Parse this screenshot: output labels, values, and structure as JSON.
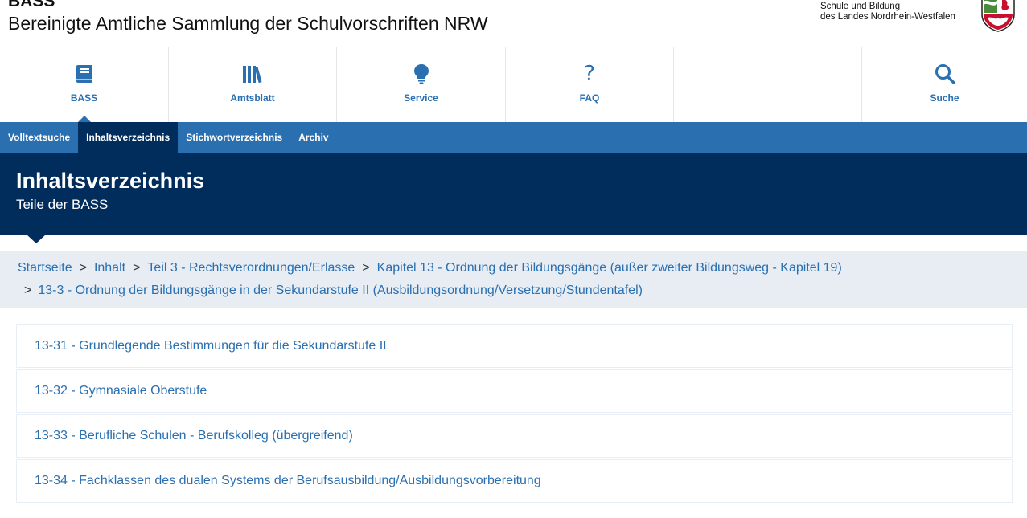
{
  "header": {
    "short_title": "BASS",
    "title": "Bereinigte Amtliche Sammlung der Schulvorschriften NRW",
    "ministry_line1": "Schule und Bildung",
    "ministry_line2": "des Landes Nordrhein-Westfalen"
  },
  "mainnav": [
    {
      "label": "BASS",
      "icon": "book-icon"
    },
    {
      "label": "Amtsblatt",
      "icon": "books-icon"
    },
    {
      "label": "Service",
      "icon": "lightbulb-icon"
    },
    {
      "label": "FAQ",
      "icon": "question-icon"
    },
    {
      "label": "Suche",
      "icon": "search-icon"
    }
  ],
  "subnav": [
    {
      "label": "Volltextsuche"
    },
    {
      "label": "Inhaltsverzeichnis",
      "active": true
    },
    {
      "label": "Stichwortverzeichnis"
    },
    {
      "label": "Archiv"
    }
  ],
  "page": {
    "title": "Inhaltsverzeichnis",
    "subtitle": "Teile der BASS"
  },
  "breadcrumb": {
    "items": [
      "Startseite",
      "Inhalt",
      "Teil 3 - Rechtsverordnungen/Erlasse",
      "Kapitel 13 - Ordnung der Bildungsgänge (außer zweiter Bildungsweg - Kapitel 19)",
      "13-3 - Ordnung der Bildungsgänge in der Sekundarstufe II (Ausbildungsordnung/Versetzung/Stundentafel)"
    ],
    "separator": ">"
  },
  "entries": [
    "13-31 - Grundlegende Bestimmungen für die Sekundarstufe II",
    "13-32 - Gymnasiale Oberstufe",
    "13-33 - Berufliche Schulen - Berufskolleg (übergreifend)",
    "13-34 - Fachklassen des dualen Systems der Berufsausbildung/Ausbildungsvorbereitung"
  ],
  "colors": {
    "primary": "#2a6fb0",
    "dark": "#002d5c",
    "breadcrumb_bg": "#e8edf4"
  }
}
